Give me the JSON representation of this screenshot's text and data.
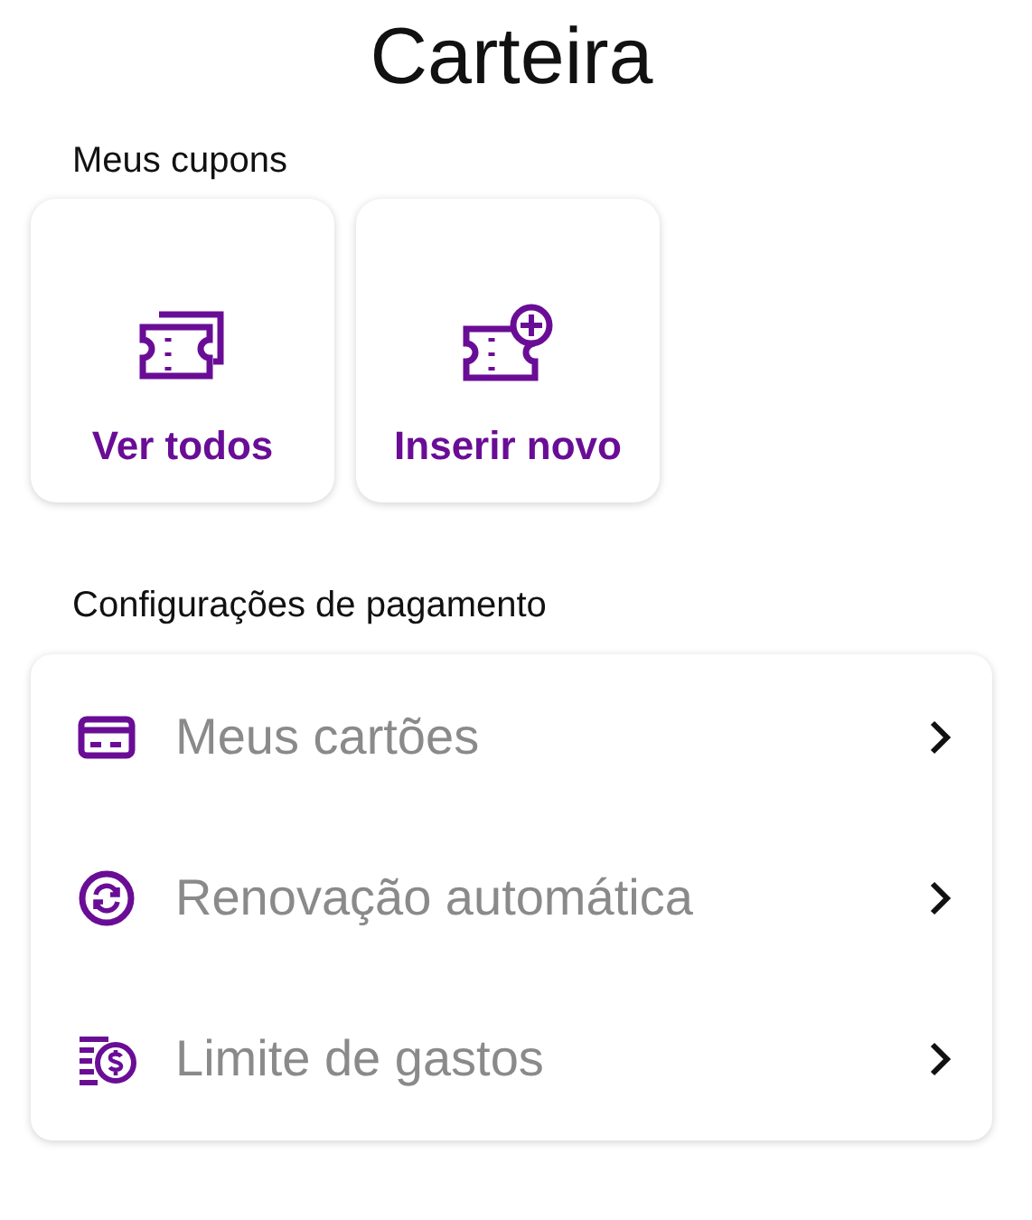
{
  "title": "Carteira",
  "coupons": {
    "heading": "Meus cupons",
    "tiles": [
      {
        "label": "Ver todos",
        "kind": "tickets"
      },
      {
        "label": "Inserir novo",
        "kind": "add"
      }
    ]
  },
  "payment": {
    "heading": "Configurações de pagamento",
    "items": [
      {
        "label": "Meus cartões",
        "kind": "card"
      },
      {
        "label": "Renovação automática",
        "kind": "renew"
      },
      {
        "label": "Limite de gastos",
        "kind": "limit"
      }
    ]
  }
}
